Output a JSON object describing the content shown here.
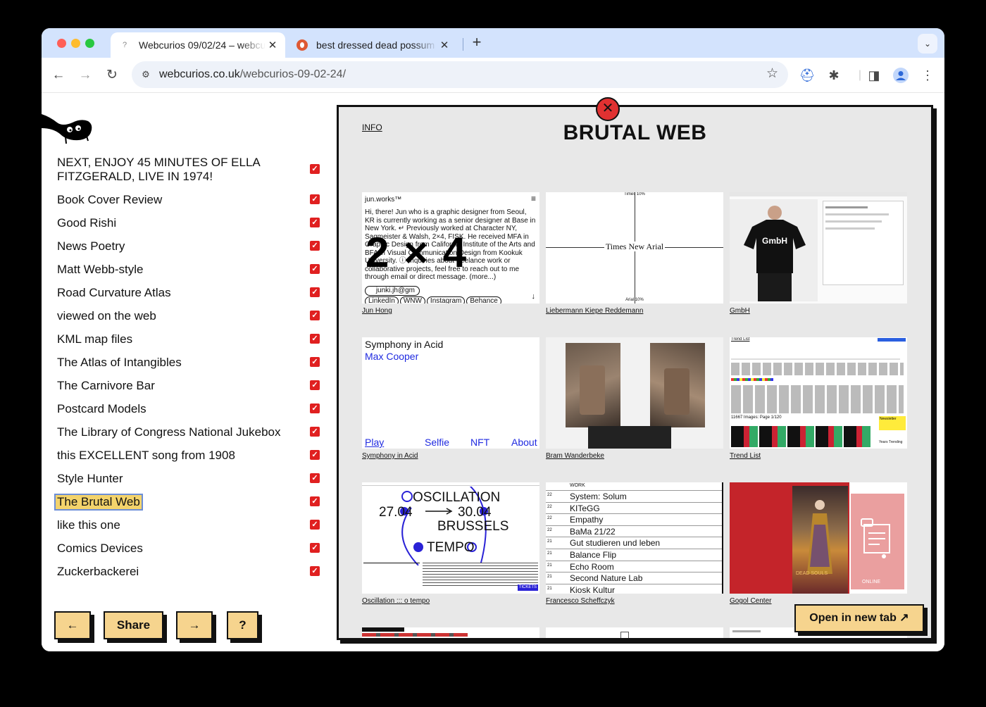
{
  "browser": {
    "tabs": [
      {
        "title": "Webcurios 09/02/24 – webcu",
        "active": true
      },
      {
        "title": "best dressed dead possum at",
        "active": false
      }
    ],
    "url_host": "webcurios.co.uk",
    "url_path": "/webcurios-09-02-24/"
  },
  "sidebar": {
    "items": [
      "NEXT, ENJOY 45 MINUTES OF ELLA FITZGERALD, LIVE IN 1974!",
      "Book Cover Review",
      "Good Rishi",
      "News Poetry",
      "Matt Webb-style",
      "Road Curvature Atlas",
      "viewed on the web",
      "KML map files",
      "The Atlas of Intangibles",
      "The Carnivore Bar",
      "Postcard Models",
      "The Library of Congress National Jukebox",
      "this EXCELLENT song from 1908",
      "Style Hunter",
      "The Brutal Web",
      "like this one",
      "Comics Devices",
      "Zuckerbackerei"
    ],
    "controls": {
      "prev": "←",
      "share": "Share",
      "next": "→",
      "help": "?"
    }
  },
  "panel": {
    "info": "INFO",
    "title": "BRUTAL WEB",
    "overlay": "2 × 4",
    "open_tab": "Open in new tab ↗",
    "sites": [
      {
        "name": "Jun Hong"
      },
      {
        "name": "Liebermann Kiepe Reddemann"
      },
      {
        "name": "GmbH"
      },
      {
        "name": "Symphony in Acid"
      },
      {
        "name": "Bram Wanderbeke"
      },
      {
        "name": "Trend List"
      },
      {
        "name": "Oscillation ::: o tempo"
      },
      {
        "name": "Francesco Scheffczyk"
      },
      {
        "name": "Gogol Center"
      }
    ],
    "jun": {
      "brand": "jun.works™",
      "text": "Hi, there! Jun who is a graphic designer from Seoul, KR is currently working as a senior designer at Base in New York. ↵ Previously worked at Character NY, Sagmeister & Walsh, 2×4, FISK. He received MFA in Graphic Design from California Institute of the Arts and BFA in Visual Communication Design from Kookuk University. ⓘ Inquiries about freelance work or collaborative projects, feel free to reach out to me through email or direct message. (more...)",
      "email": "junki.jh@gm",
      "links": [
        "LinkedIn",
        "WNW",
        "Instagram",
        "Behance"
      ]
    },
    "lkr": {
      "top": "Times 10%",
      "center": "Times New Arial",
      "bottom": "Arial 10%"
    },
    "symphony": {
      "title": "Symphony in Acid",
      "artist": "Max Cooper",
      "nav": [
        "Play",
        "Selfie",
        "NFT",
        "About"
      ]
    },
    "oscillation": {
      "line1": "OSCILLATION",
      "from": "27.04",
      "to": "30.04",
      "city": "BRUSSELS",
      "word": "TEMPO",
      "tickets": "TICKETS"
    },
    "scheffczyk": {
      "header": "WORK",
      "rows": [
        {
          "n": "22",
          "t": "System: Solum"
        },
        {
          "n": "22",
          "t": "KITeGG"
        },
        {
          "n": "22",
          "t": "Empathy"
        },
        {
          "n": "22",
          "t": "BaMa 21/22"
        },
        {
          "n": "21",
          "t": "Gut studieren und leben"
        },
        {
          "n": "21",
          "t": "Balance Flip"
        },
        {
          "n": "21",
          "t": "Echo Room"
        },
        {
          "n": "21",
          "t": "Second Nature Lab"
        },
        {
          "n": "21",
          "t": "Kiosk Kultur"
        }
      ]
    },
    "gogol": {
      "poster": "DEAD SOULS",
      "side": "ONLINE"
    },
    "trend": {
      "title": "Trend List",
      "count": "11667 Images: Page 1/120",
      "newsletter": "Newsletter",
      "years": "Years Trending"
    }
  }
}
